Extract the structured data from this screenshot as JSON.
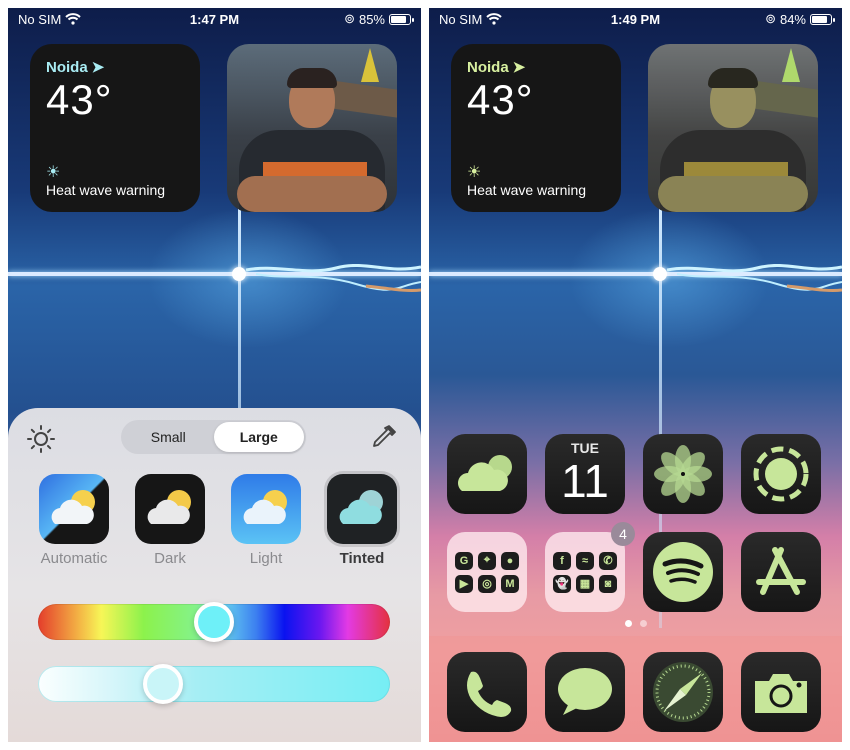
{
  "left_screen": {
    "status": {
      "carrier": "No SIM",
      "time": "1:47 PM",
      "battery": "85%",
      "battery_level": 0.85
    },
    "weather_widget": {
      "city": "Noida",
      "temperature": "43°",
      "condition": "Heat wave warning",
      "icon": "sun-icon"
    },
    "photo_widget": {
      "description": "photo of person with crossed arms"
    },
    "customize_panel": {
      "size_options": [
        {
          "label": "Small",
          "selected": false
        },
        {
          "label": "Large",
          "selected": true
        }
      ],
      "styles": [
        {
          "label": "Automatic",
          "selected": false
        },
        {
          "label": "Dark",
          "selected": false
        },
        {
          "label": "Light",
          "selected": false
        },
        {
          "label": "Tinted",
          "selected": true
        }
      ],
      "hue_slider": {
        "value": 0.5
      },
      "saturation_slider": {
        "value": 0.34
      },
      "tint_color": "#6ef0f8"
    }
  },
  "right_screen": {
    "status": {
      "carrier": "No SIM",
      "time": "1:49 PM",
      "battery": "84%",
      "battery_level": 0.84
    },
    "weather_widget": {
      "city": "Noida",
      "temperature": "43°",
      "condition": "Heat wave warning",
      "icon": "sun-icon"
    },
    "apps": [
      {
        "name": "Weather",
        "icon": "cloud-icon"
      },
      {
        "name": "Calendar",
        "icon": "calendar-icon",
        "day": "TUE",
        "date": "11"
      },
      {
        "name": "Photos",
        "icon": "flower-icon"
      },
      {
        "name": "Activity",
        "icon": "circle-dashed-icon"
      },
      {
        "name": "Google folder",
        "icon": "folder-icon",
        "mini_apps": [
          "G",
          "⌖",
          "●",
          "▶",
          "◎",
          "M"
        ]
      },
      {
        "name": "Social folder",
        "icon": "folder-icon",
        "badge": "4",
        "mini_apps": [
          "f",
          "≈",
          "✆",
          "👻",
          "▦",
          "◙"
        ]
      },
      {
        "name": "Spotify",
        "icon": "spotify-icon"
      },
      {
        "name": "App Store",
        "icon": "appstore-icon"
      }
    ],
    "page_dots": {
      "count": 2,
      "current": 1
    },
    "dock": [
      {
        "name": "Phone",
        "icon": "phone-icon"
      },
      {
        "name": "Messages",
        "icon": "message-icon"
      },
      {
        "name": "Safari",
        "icon": "compass-icon"
      },
      {
        "name": "Camera",
        "icon": "camera-icon"
      }
    ],
    "tint_color": "#c7e69a"
  }
}
